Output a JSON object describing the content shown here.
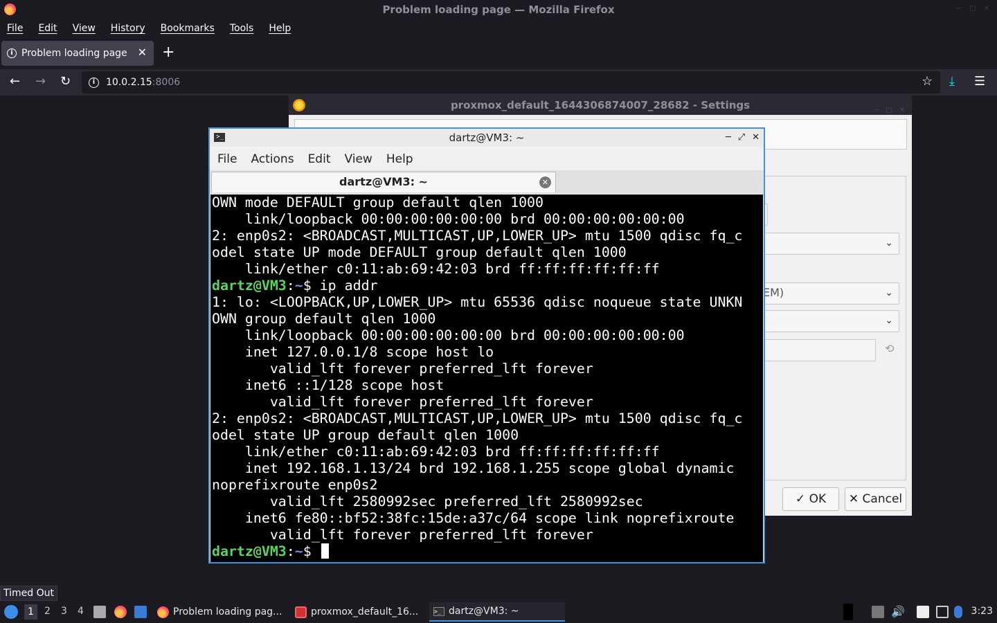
{
  "firefox": {
    "window_title": "Problem loading page — Mozilla Firefox",
    "menu": [
      "File",
      "Edit",
      "View",
      "History",
      "Bookmarks",
      "Tools",
      "Help"
    ],
    "tab_title": "Problem loading page",
    "url_host": "10.0.2.15",
    "url_port": ":8006",
    "status_text": "Timed Out"
  },
  "settings_dialog": {
    "title": "proxmox_default_1644306874007_28682 - Settings",
    "field_partial_text": "EM)",
    "ok_label": "OK",
    "cancel_label": "Cancel"
  },
  "terminal": {
    "window_title": "dartz@VM3: ~",
    "menu": [
      "File",
      "Actions",
      "Edit",
      "View",
      "Help"
    ],
    "tab_title": "dartz@VM3: ~",
    "prompt_user": "dartz@VM3",
    "prompt_sep": ":",
    "prompt_path": "~",
    "prompt_end": "$ ",
    "lines": [
      {
        "text": "OWN mode DEFAULT group default qlen 1000"
      },
      {
        "text": "    link/loopback 00:00:00:00:00:00 brd 00:00:00:00:00:00"
      },
      {
        "text": "2: enp0s2: <BROADCAST,MULTICAST,UP,LOWER_UP> mtu 1500 qdisc fq_c"
      },
      {
        "text": "odel state UP mode DEFAULT group default qlen 1000"
      },
      {
        "text": "    link/ether c0:11:ab:69:42:03 brd ff:ff:ff:ff:ff:ff"
      },
      {
        "prompt": true,
        "cmd": "ip addr"
      },
      {
        "text": "1: lo: <LOOPBACK,UP,LOWER_UP> mtu 65536 qdisc noqueue state UNKN"
      },
      {
        "text": "OWN group default qlen 1000"
      },
      {
        "text": "    link/loopback 00:00:00:00:00:00 brd 00:00:00:00:00:00"
      },
      {
        "text": "    inet 127.0.0.1/8 scope host lo"
      },
      {
        "text": "       valid_lft forever preferred_lft forever"
      },
      {
        "text": "    inet6 ::1/128 scope host"
      },
      {
        "text": "       valid_lft forever preferred_lft forever"
      },
      {
        "text": "2: enp0s2: <BROADCAST,MULTICAST,UP,LOWER_UP> mtu 1500 qdisc fq_c"
      },
      {
        "text": "odel state UP group default qlen 1000"
      },
      {
        "text": "    link/ether c0:11:ab:69:42:03 brd ff:ff:ff:ff:ff:ff"
      },
      {
        "text": "    inet 192.168.1.13/24 brd 192.168.1.255 scope global dynamic"
      },
      {
        "text": "noprefixroute enp0s2"
      },
      {
        "text": "       valid_lft 2580992sec preferred_lft 2580992sec"
      },
      {
        "text": "    inet6 fe80::bf52:38fc:15de:a37c/64 scope link noprefixroute"
      },
      {
        "text": "       valid_lft forever preferred_lft forever"
      },
      {
        "prompt": true,
        "cmd": "",
        "cursor": true
      }
    ]
  },
  "taskbar": {
    "workspaces": [
      "1",
      "2",
      "3",
      "4"
    ],
    "active_workspace": "1",
    "tasks": [
      {
        "label": "Problem loading pag...",
        "icon": "firefox-icon"
      },
      {
        "label": "proxmox_default_16...",
        "icon": "virtualbox-icon"
      },
      {
        "label": "dartz@VM3: ~",
        "icon": "terminal-icon",
        "active": true
      }
    ],
    "clock": "3:23"
  },
  "colors": {
    "accent": "#4a90d9",
    "prompt_green": "#5fd35f",
    "prompt_blue": "#6b8ff2",
    "ff_bg": "#1c1b22"
  }
}
